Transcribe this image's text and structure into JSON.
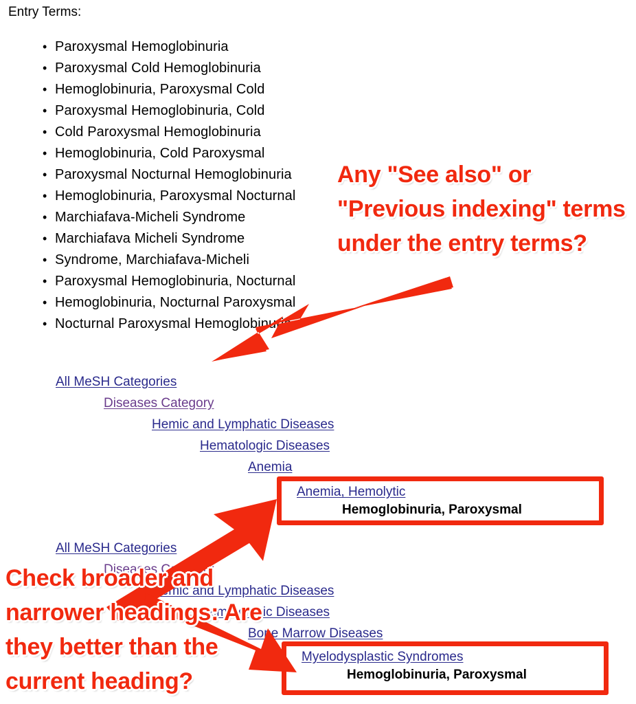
{
  "page": {
    "heading": "Entry Terms:",
    "accent_red": "#f1290f",
    "link_blue": "#2a2a8c",
    "link_visited_purple": "#6a3c8c"
  },
  "entry_terms": [
    "Paroxysmal Hemoglobinuria",
    "Paroxysmal Cold Hemoglobinuria",
    "Hemoglobinuria, Paroxysmal Cold",
    "Paroxysmal Hemoglobinuria, Cold",
    "Cold Paroxysmal Hemoglobinuria",
    "Hemoglobinuria, Cold Paroxysmal",
    "Paroxysmal Nocturnal Hemoglobinuria",
    "Hemoglobinuria, Paroxysmal Nocturnal",
    "Marchiafava-Micheli Syndrome",
    "Marchiafava Micheli Syndrome",
    "Syndrome, Marchiafava-Micheli",
    "Paroxysmal Hemoglobinuria, Nocturnal",
    "Hemoglobinuria, Nocturnal Paroxysmal",
    "Nocturnal Paroxysmal Hemoglobinuria"
  ],
  "tree_1": {
    "rows": [
      {
        "label": "All MeSH Categories",
        "visited": false
      },
      {
        "label": "Diseases Category",
        "visited": true
      },
      {
        "label": "Hemic and Lymphatic Diseases",
        "visited": false
      },
      {
        "label": "Hematologic Diseases",
        "visited": false
      },
      {
        "label": "Anemia",
        "visited": false
      }
    ],
    "highlight": {
      "link": "Anemia, Hemolytic",
      "current": "Hemoglobinuria, Paroxysmal"
    }
  },
  "tree_2": {
    "rows": [
      {
        "label": "All MeSH Categories",
        "visited": false
      },
      {
        "label": "Diseases Category",
        "visited": true
      },
      {
        "label": "Hemic and Lymphatic Diseases",
        "visited": false
      },
      {
        "label": "Hematologic Diseases",
        "visited": false
      },
      {
        "label": "Bone Marrow Diseases",
        "visited": false
      }
    ],
    "highlight": {
      "link": "Myelodysplastic Syndromes",
      "current": "Hemoglobinuria, Paroxysmal"
    }
  },
  "annotations": [
    {
      "id": "see-also-question",
      "text": "Any \"See also\" or \"Previous indexing\" terms under the entry terms?"
    },
    {
      "id": "broader-narrower-question",
      "text": "Check broader and narrower headings: Are they better than the current heading?"
    }
  ]
}
